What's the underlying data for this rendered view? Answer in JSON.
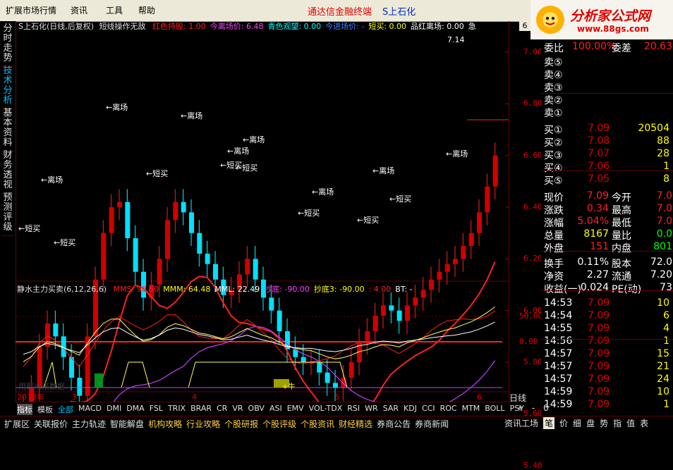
{
  "menubar": {
    "items": [
      "扩展市场行情",
      "资讯",
      "工具",
      "帮助"
    ],
    "title": "通达信金融终端",
    "stock_name": "S上石化"
  },
  "logo": {
    "text": "分析家公式网",
    "url": "www.88gs.com"
  },
  "left_tabs": [
    "分时走势",
    "技术分析",
    "基本资料",
    "财务透视",
    "预测评级"
  ],
  "main_chart": {
    "title": "S上石化(日线,后复权)",
    "indicator_name": "短线操作无敌",
    "fields": [
      {
        "label": "红色持股: 1.00",
        "color": "#ff2020"
      },
      {
        "label": "今离场价: 6.48",
        "color": "#ff40ff"
      },
      {
        "label": "青色观望: 0.00",
        "color": "#00ffff"
      },
      {
        "label": "今进场价: -",
        "color": "#4080ff"
      },
      {
        "label": "短买: 0.00",
        "color": "#ffff00"
      },
      {
        "label": "品红离场: 0.00",
        "color": "#ffffff"
      },
      {
        "label": "急",
        "color": "#ffffff"
      }
    ],
    "last_price_label": "7.14",
    "y_ticks": [
      "7.00",
      "6.80",
      "6.60",
      "6.40",
      "6.20",
      "6.00",
      "5.80",
      "5.60",
      "5.40"
    ],
    "annotations": [
      {
        "text": "←离场",
        "color": "#ffffff"
      },
      {
        "text": "←离场",
        "color": "#ffffff"
      },
      {
        "text": "←离场",
        "color": "#ffffff"
      },
      {
        "text": "←离场",
        "color": "#ffffff"
      },
      {
        "text": "←离场",
        "color": "#ffffff"
      },
      {
        "text": "←离场",
        "color": "#ffffff"
      },
      {
        "text": "←离场",
        "color": "#ffffff"
      },
      {
        "text": "←离场",
        "color": "#ffffff"
      },
      {
        "text": "←短买",
        "color": "#ffffff"
      },
      {
        "text": "←短买",
        "color": "#ffffff"
      },
      {
        "text": "←短买",
        "color": "#ffffff"
      },
      {
        "text": "←短买",
        "color": "#ffffff"
      },
      {
        "text": "←短买",
        "color": "#ffffff"
      },
      {
        "text": "←短买",
        "color": "#ffffff"
      },
      {
        "text": "←短买",
        "color": "#ffffff"
      },
      {
        "text": "←短买",
        "color": "#ffffff"
      }
    ]
  },
  "sub_chart": {
    "title": "静水主力买卖(6,12,26,6)",
    "fields": [
      {
        "label": "MMS: 90.60",
        "color": "#ff2020"
      },
      {
        "label": "MMM: 64.48",
        "color": "#ffff00"
      },
      {
        "label": "MML: 22.49",
        "color": "#ffffff"
      },
      {
        "label": "抄底: -90.00",
        "color": "#ff40ff"
      },
      {
        "label": "抄底3: -90.00",
        "color": "#ffff00"
      },
      {
        "label": ": 4.00",
        "color": "#ff2020"
      },
      {
        "label": "BT: -",
        "color": "#ffffff"
      }
    ],
    "y_ticks": [
      "50.00",
      "0.00"
    ],
    "watermark": "用到未来数据",
    "signal": "+牛"
  },
  "x_axis": {
    "year_label": "2013年",
    "ticks": [
      "3",
      "4",
      "5",
      "6"
    ],
    "period": "日线"
  },
  "quote_panel": {
    "webi_label": "委比",
    "webi_value": "100.00%",
    "weicha_label": "委差",
    "weicha_value": "20.63",
    "sell": [
      {
        "label": "卖⑤",
        "price": "",
        "vol": ""
      },
      {
        "label": "卖④",
        "price": "",
        "vol": ""
      },
      {
        "label": "卖③",
        "price": "",
        "vol": ""
      },
      {
        "label": "卖②",
        "price": "",
        "vol": ""
      },
      {
        "label": "卖①",
        "price": "",
        "vol": ""
      }
    ],
    "buy": [
      {
        "label": "买①",
        "price": "7.09",
        "vol": "20504"
      },
      {
        "label": "买②",
        "price": "7.08",
        "vol": "88"
      },
      {
        "label": "买③",
        "price": "7.07",
        "vol": "28"
      },
      {
        "label": "买④",
        "price": "7.06",
        "vol": "1"
      },
      {
        "label": "买⑤",
        "price": "7.05",
        "vol": "8"
      }
    ],
    "stats": [
      {
        "l1": "现价",
        "v1": "7.09",
        "l2": "今开",
        "v2": "7.0",
        "c1": "#ff2020",
        "c2": "#ff2020"
      },
      {
        "l1": "涨跌",
        "v1": "0.34",
        "l2": "最高",
        "v2": "7.0",
        "c1": "#ff2020",
        "c2": "#ff2020"
      },
      {
        "l1": "涨幅",
        "v1": "5.04%",
        "l2": "最低",
        "v2": "7.0",
        "c1": "#ff2020",
        "c2": "#ff2020"
      },
      {
        "l1": "总量",
        "v1": "8167",
        "l2": "量比",
        "v2": "0.0",
        "c1": "#ffff00",
        "c2": "#00ff00"
      },
      {
        "l1": "外盘",
        "v1": "151",
        "l2": "内盘",
        "v2": "801",
        "c1": "#ff2020",
        "c2": "#00ff00"
      }
    ],
    "stats2": [
      {
        "l1": "换手",
        "v1": "0.11%",
        "l2": "股本",
        "v2": "72.0"
      },
      {
        "l1": "净资",
        "v1": "2.27",
        "l2": "流通",
        "v2": "7.20"
      },
      {
        "l1": "收益(一)",
        "v1": "0.024",
        "l2": "PE(动)",
        "v2": "73"
      }
    ],
    "ticks": [
      {
        "time": "14:53",
        "price": "7.09",
        "vol": "10"
      },
      {
        "time": "14:54",
        "price": "7.09",
        "vol": "6"
      },
      {
        "time": "14:55",
        "price": "7.09",
        "vol": "4"
      },
      {
        "time": "14:56",
        "price": "7.09",
        "vol": "1"
      },
      {
        "time": "14:57",
        "price": "7.09",
        "vol": "15"
      },
      {
        "time": "14:57",
        "price": "7.09",
        "vol": "21"
      },
      {
        "time": "14:57",
        "price": "7.09",
        "vol": "24"
      },
      {
        "time": "14:59",
        "price": "7.09",
        "vol": "10"
      },
      {
        "time": "14:59",
        "price": "7.09",
        "vol": "1"
      }
    ],
    "top_right_code": "6"
  },
  "indicator_tabs": [
    "指标",
    "模板",
    "全部",
    "MACD",
    "DMI",
    "DMA",
    "FSL",
    "TRIX",
    "BRAR",
    "CR",
    "VR",
    "OBV",
    "ASI",
    "EMV",
    "VOL-TDX",
    "RSI",
    "WR",
    "SAR",
    "KDJ",
    "CCI",
    "ROC",
    "MTM",
    "BOLL",
    "PSY"
  ],
  "controls": {
    "plus": "+",
    "minus": "-",
    "zero": "0"
  },
  "taskbar": [
    "扩展区",
    "关联报价",
    "主力轨迹",
    "智能解盘",
    "机构攻略",
    "行业攻略",
    "个股研报",
    "个股评级",
    "个股资讯",
    "财经精选",
    "券商公告",
    "券商新闻"
  ],
  "right_tabs": [
    "资讯工场",
    "笔",
    "价",
    "细",
    "盘",
    "势",
    "指",
    "值",
    "表"
  ]
}
